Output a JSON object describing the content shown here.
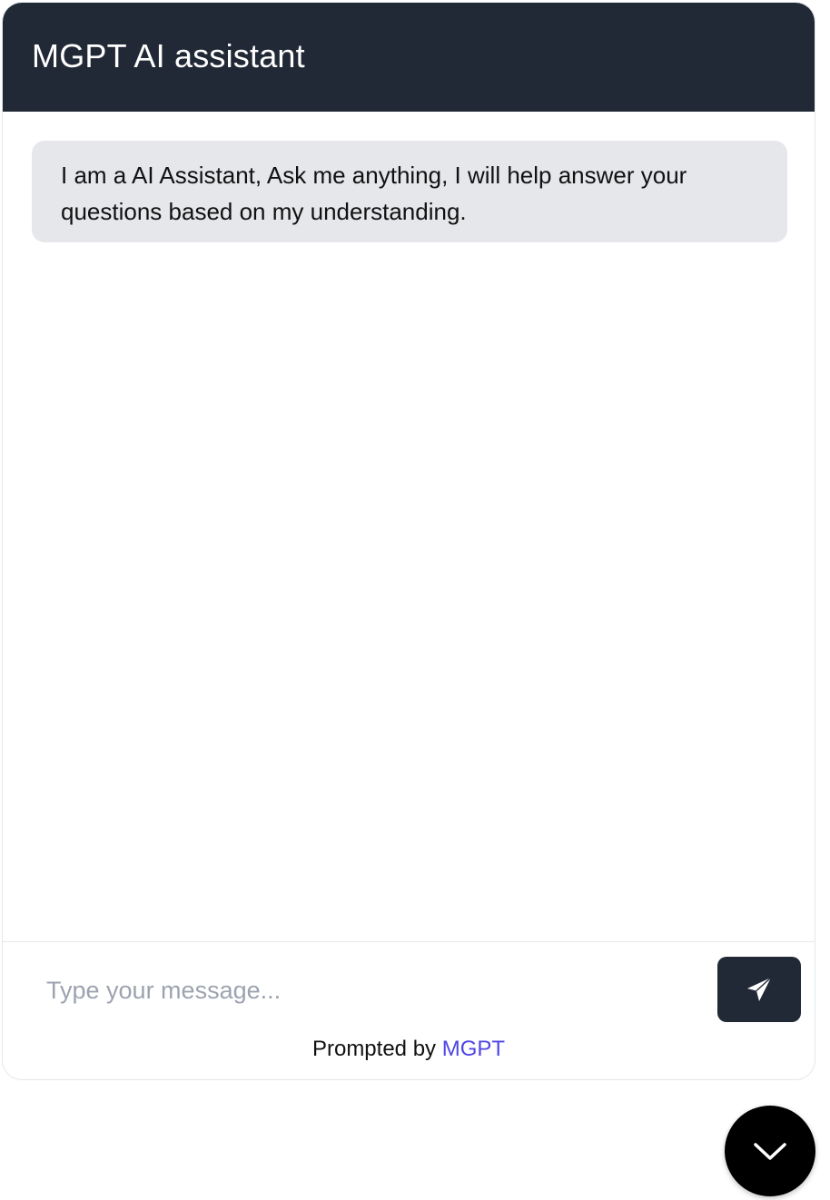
{
  "header": {
    "title": "MGPT AI assistant",
    "background_color": "#222936"
  },
  "messages": [
    {
      "role": "assistant",
      "text": "I am a AI Assistant, Ask me anything, I will help answer your questions based on my understanding."
    }
  ],
  "composer": {
    "placeholder": "Type your message...",
    "value": "",
    "send_icon": "paper-plane-icon"
  },
  "credit": {
    "prefix": "Prompted by ",
    "link_text": "MGPT",
    "link_color": "#4f46e5"
  },
  "toggle": {
    "icon": "chevron-down-icon"
  }
}
